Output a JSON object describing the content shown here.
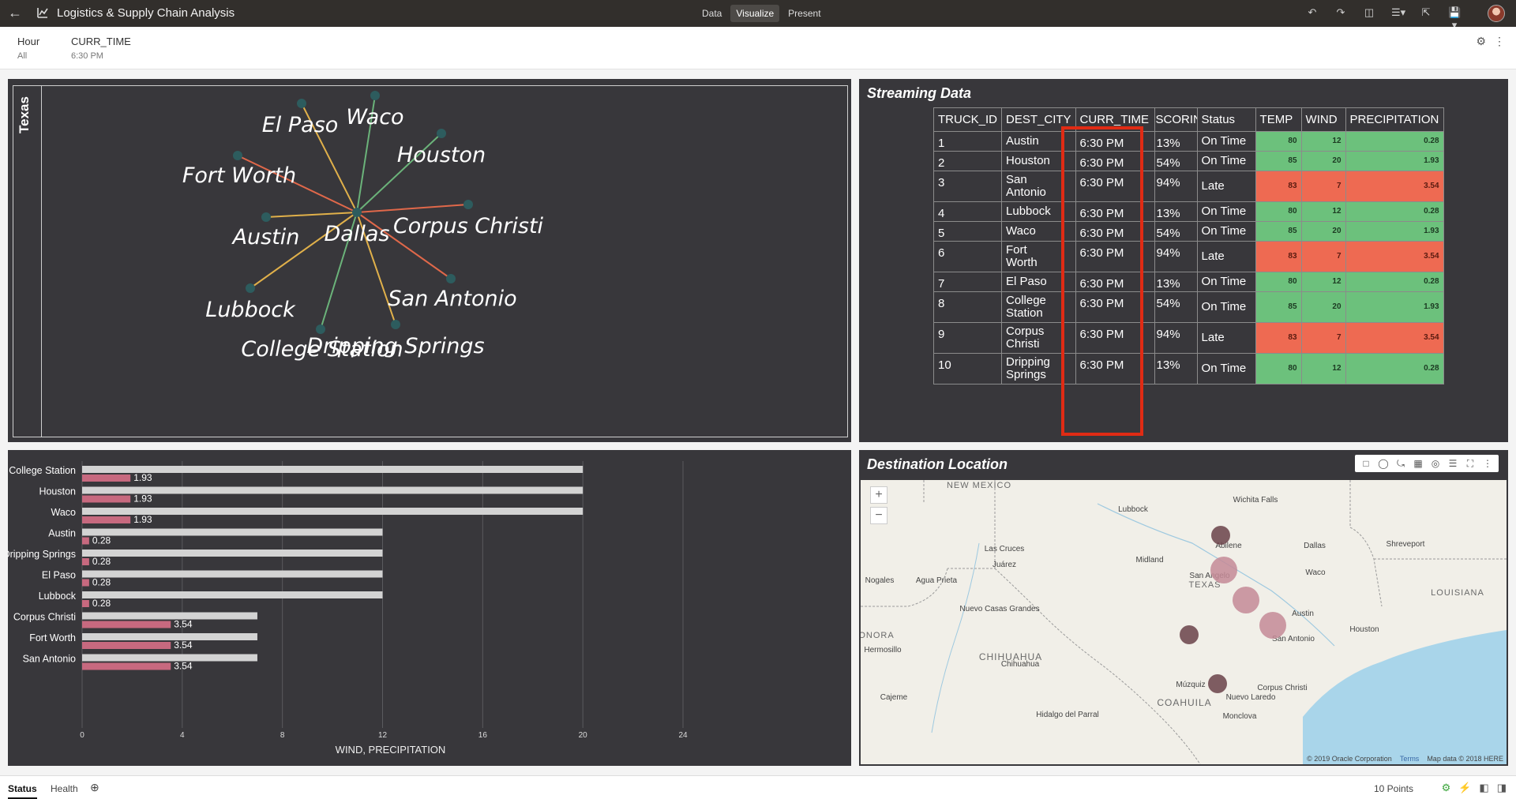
{
  "app": {
    "title": "Logistics & Supply Chain Analysis",
    "modes": [
      "Data",
      "Visualize",
      "Present"
    ],
    "active_mode": "Visualize"
  },
  "filters": [
    {
      "label": "Hour",
      "value": "All"
    },
    {
      "label": "CURR_TIME",
      "value": "6:30 PM"
    }
  ],
  "network": {
    "side_label": "Texas",
    "hub": "Dallas",
    "nodes": [
      "El Paso",
      "Waco",
      "Houston",
      "Fort Worth",
      "Austin",
      "Corpus Christi",
      "San Antonio",
      "Lubbock",
      "College Station",
      "Dripping Springs"
    ]
  },
  "stream": {
    "title": "Streaming Data",
    "columns": [
      "TRUCK_ID",
      "DEST_CITY",
      "CURR_TIME",
      "SCORIN",
      "Status",
      "TEMP",
      "WIND",
      "PRECIPITATION"
    ],
    "rows": [
      {
        "id": "1",
        "city": [
          "Austin"
        ],
        "time": "6:30 PM",
        "score": "13%",
        "status": "On Time",
        "temp": "80",
        "wind": "12",
        "precip": "0.28",
        "color": "g"
      },
      {
        "id": "2",
        "city": [
          "Houston"
        ],
        "time": "6:30 PM",
        "score": "54%",
        "status": "On Time",
        "temp": "85",
        "wind": "20",
        "precip": "1.93",
        "color": "g"
      },
      {
        "id": "3",
        "city": [
          "San",
          "Antonio"
        ],
        "time": "6:30 PM",
        "score": "94%",
        "status": "Late",
        "temp": "83",
        "wind": "7",
        "precip": "3.54",
        "color": "r"
      },
      {
        "id": "4",
        "city": [
          "Lubbock"
        ],
        "time": "6:30 PM",
        "score": "13%",
        "status": "On Time",
        "temp": "80",
        "wind": "12",
        "precip": "0.28",
        "color": "g"
      },
      {
        "id": "5",
        "city": [
          "Waco"
        ],
        "time": "6:30 PM",
        "score": "54%",
        "status": "On Time",
        "temp": "85",
        "wind": "20",
        "precip": "1.93",
        "color": "g"
      },
      {
        "id": "6",
        "city": [
          "Fort",
          "Worth"
        ],
        "time": "6:30 PM",
        "score": "94%",
        "status": "Late",
        "temp": "83",
        "wind": "7",
        "precip": "3.54",
        "color": "r"
      },
      {
        "id": "7",
        "city": [
          "El Paso"
        ],
        "time": "6:30 PM",
        "score": "13%",
        "status": "On Time",
        "temp": "80",
        "wind": "12",
        "precip": "0.28",
        "color": "g"
      },
      {
        "id": "8",
        "city": [
          "College",
          "Station"
        ],
        "time": "6:30 PM",
        "score": "54%",
        "status": "On Time",
        "temp": "85",
        "wind": "20",
        "precip": "1.93",
        "color": "g"
      },
      {
        "id": "9",
        "city": [
          "Corpus",
          "Christi"
        ],
        "time": "6:30 PM",
        "score": "94%",
        "status": "Late",
        "temp": "83",
        "wind": "7",
        "precip": "3.54",
        "color": "r"
      },
      {
        "id": "10",
        "city": [
          "Dripping",
          "Springs"
        ],
        "time": "6:30 PM",
        "score": "13%",
        "status": "On Time",
        "temp": "80",
        "wind": "12",
        "precip": "0.28",
        "color": "g"
      }
    ]
  },
  "chart_data": {
    "type": "bar",
    "orientation": "horizontal",
    "categories": [
      "College Station",
      "Houston",
      "Waco",
      "Austin",
      "Dripping Springs",
      "El Paso",
      "Lubbock",
      "Corpus Christi",
      "Fort Worth",
      "San Antonio"
    ],
    "series": [
      {
        "values": [
          20,
          20,
          20,
          12,
          12,
          12,
          12,
          7,
          7,
          7
        ],
        "color": "#d3d3d3"
      },
      {
        "values": [
          1.93,
          1.93,
          1.93,
          0.28,
          0.28,
          0.28,
          0.28,
          3.54,
          3.54,
          3.54
        ],
        "color": "#c7697f",
        "labels": [
          "1.93",
          "1.93",
          "1.93",
          "0.28",
          "0.28",
          "0.28",
          "0.28",
          "3.54",
          "3.54",
          "3.54"
        ]
      }
    ],
    "xlabel": "WIND, PRECIPITATION",
    "xlim": [
      0,
      24
    ],
    "xticks": [
      "0",
      "4",
      "8",
      "12",
      "16",
      "20",
      "24"
    ],
    "grid": true
  },
  "map": {
    "title": "Destination Location",
    "places": [
      "NEW MEXICO",
      "Lubbock",
      "Wichita Falls",
      "Dallas",
      "Shreveport",
      "Las Cruces",
      "Abilene",
      "Juárez",
      "Midland",
      "Waco",
      "Nogales",
      "Agua Prieta",
      "San Angelo",
      "TEXAS",
      "LOUISIANA",
      "Nuevo Casas Grandes",
      "Austin",
      "ONORA",
      "San Antonio",
      "Houston",
      "Hermosillo",
      "CHIHUAHUA",
      "Chihuahua",
      "Múzquiz",
      "Corpus Christi",
      "Cajeme",
      "COAHUILA",
      "Nuevo Laredo",
      "Hidalgo del Parral",
      "Monclova"
    ],
    "credits": [
      "© 2019 Oracle Corporation",
      "Terms",
      "Map data © 2018 HERE"
    ],
    "zoom_in": "+",
    "zoom_out": "−"
  },
  "status": {
    "tabs": [
      "Status",
      "Health"
    ],
    "points": "10 Points"
  },
  "icons": [
    "back-arrow-icon",
    "chart-icon",
    "undo-icon",
    "redo-icon",
    "save-icon",
    "comment-icon",
    "export-icon",
    "avatar",
    "add-canvas-icon",
    "pin-icon"
  ]
}
